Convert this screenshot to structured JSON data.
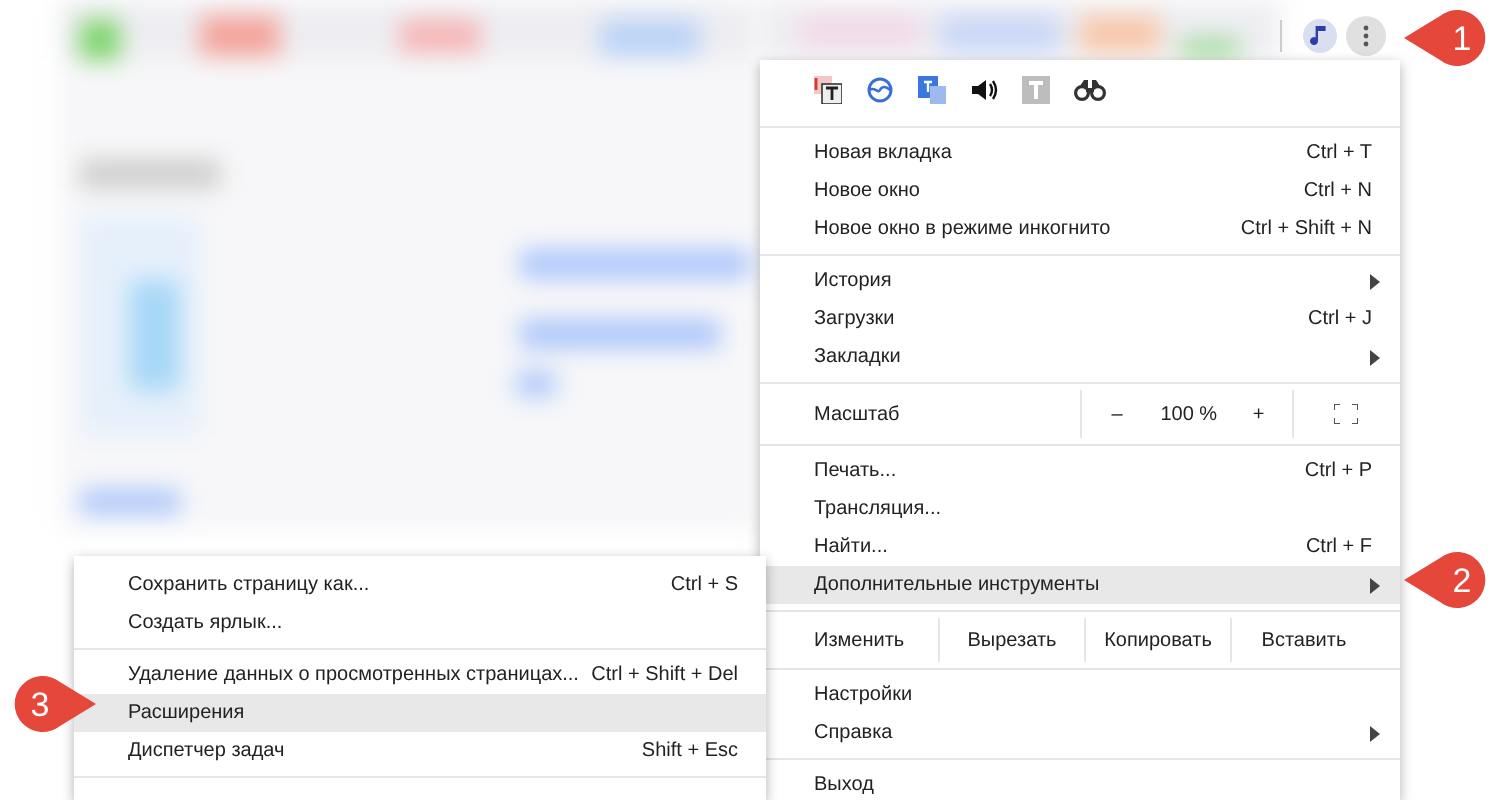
{
  "callouts": [
    {
      "label": "1",
      "kind": "left"
    },
    {
      "label": "2",
      "kind": "left"
    },
    {
      "label": "3",
      "kind": "right"
    }
  ],
  "menu": {
    "items": [
      {
        "kind": "command",
        "label": "Новая вкладка",
        "shortcut": "Ctrl + T",
        "has_submenu": false,
        "selected": false
      },
      {
        "kind": "command",
        "label": "Новое окно",
        "shortcut": "Ctrl + N",
        "has_submenu": false,
        "selected": false
      },
      {
        "kind": "command",
        "label": "Новое окно в режиме инкогнито",
        "shortcut": "Ctrl + Shift + N",
        "has_submenu": false,
        "selected": false
      },
      {
        "kind": "separator"
      },
      {
        "kind": "command",
        "label": "История",
        "has_submenu": true,
        "selected": false
      },
      {
        "kind": "command",
        "label": "Загрузки",
        "shortcut": "Ctrl + J",
        "has_submenu": false,
        "selected": false
      },
      {
        "kind": "command",
        "label": "Закладки",
        "has_submenu": true,
        "selected": false
      },
      {
        "kind": "separator"
      },
      {
        "kind": "zoom",
        "label": "Масштаб",
        "minus": "–",
        "value": "100 %",
        "plus": "+"
      },
      {
        "kind": "separator"
      },
      {
        "kind": "command",
        "label": "Печать...",
        "shortcut": "Ctrl + P",
        "has_submenu": false,
        "selected": false
      },
      {
        "kind": "command",
        "label": "Трансляция...",
        "has_submenu": false,
        "selected": false
      },
      {
        "kind": "command",
        "label": "Найти...",
        "shortcut": "Ctrl + F",
        "has_submenu": false,
        "selected": false
      },
      {
        "kind": "command",
        "label": "Дополнительные инструменты",
        "has_submenu": true,
        "selected": true
      },
      {
        "kind": "separator"
      },
      {
        "kind": "edit",
        "label": "Изменить",
        "buttons": [
          "Вырезать",
          "Копировать",
          "Вставить"
        ]
      },
      {
        "kind": "separator"
      },
      {
        "kind": "command",
        "label": "Настройки",
        "has_submenu": false,
        "selected": false
      },
      {
        "kind": "command",
        "label": "Справка",
        "has_submenu": true,
        "selected": false
      },
      {
        "kind": "separator"
      },
      {
        "kind": "command",
        "label": "Выход",
        "has_submenu": false,
        "selected": false
      }
    ]
  },
  "submenu": {
    "items": [
      {
        "kind": "command",
        "label": "Сохранить страницу как...",
        "shortcut": "Ctrl + S",
        "selected": false
      },
      {
        "kind": "command",
        "label": "Создать ярлык...",
        "selected": false
      },
      {
        "kind": "separator"
      },
      {
        "kind": "command",
        "label": "Удаление данных о просмотренных страницах...",
        "shortcut": "Ctrl + Shift + Del",
        "selected": false
      },
      {
        "kind": "command",
        "label": "Расширения",
        "selected": true
      },
      {
        "kind": "command",
        "label": "Диспетчер задач",
        "shortcut": "Shift + Esc",
        "selected": false
      },
      {
        "kind": "separator"
      }
    ]
  }
}
